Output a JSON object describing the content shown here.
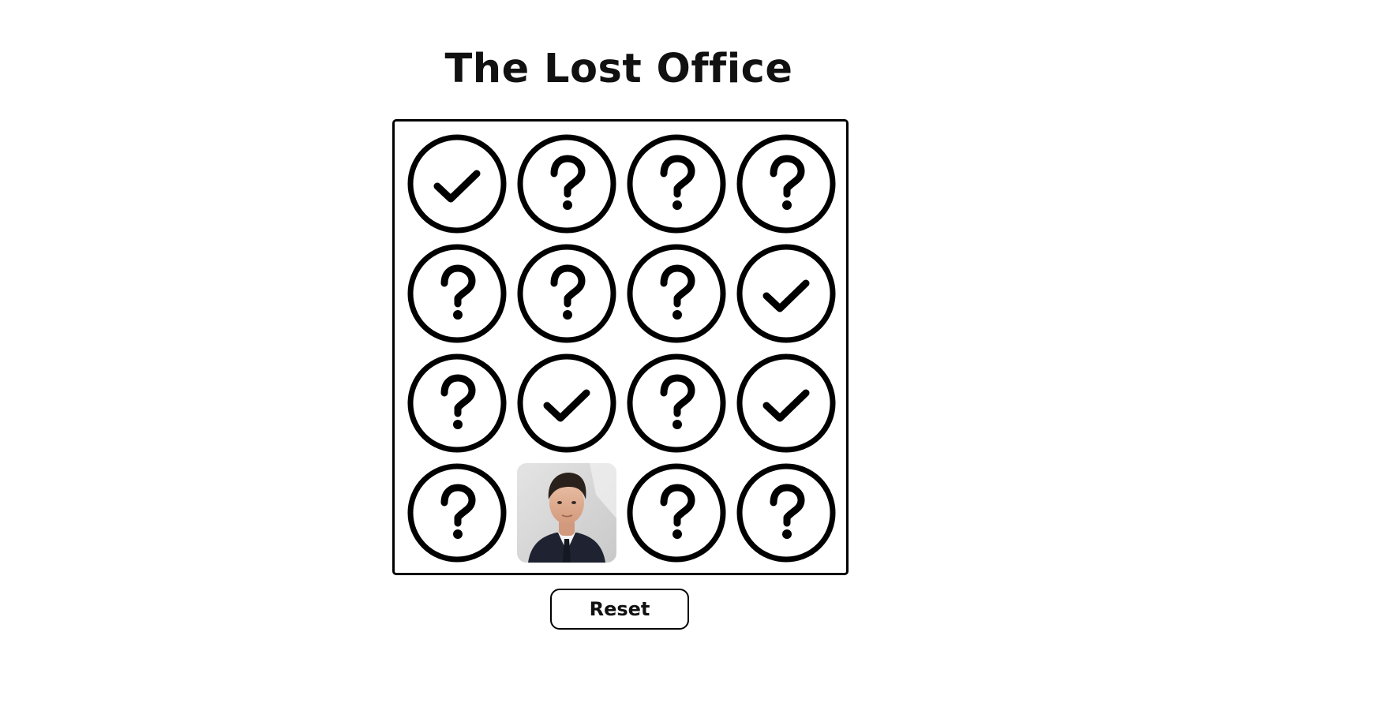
{
  "title": "The Lost Office",
  "reset_label": "Reset",
  "colors": {
    "ink": "#000000",
    "background": "#ffffff"
  },
  "tiles": [
    {
      "state": "check",
      "icon": "check-circle-icon"
    },
    {
      "state": "question",
      "icon": "question-circle-icon"
    },
    {
      "state": "question",
      "icon": "question-circle-icon"
    },
    {
      "state": "question",
      "icon": "question-circle-icon"
    },
    {
      "state": "question",
      "icon": "question-circle-icon"
    },
    {
      "state": "question",
      "icon": "question-circle-icon"
    },
    {
      "state": "question",
      "icon": "question-circle-icon"
    },
    {
      "state": "check",
      "icon": "check-circle-icon"
    },
    {
      "state": "question",
      "icon": "question-circle-icon"
    },
    {
      "state": "check",
      "icon": "check-circle-icon"
    },
    {
      "state": "question",
      "icon": "question-circle-icon"
    },
    {
      "state": "check",
      "icon": "check-circle-icon"
    },
    {
      "state": "question",
      "icon": "question-circle-icon"
    },
    {
      "state": "photo",
      "icon": "character-portrait"
    },
    {
      "state": "question",
      "icon": "question-circle-icon"
    },
    {
      "state": "question",
      "icon": "question-circle-icon"
    }
  ]
}
